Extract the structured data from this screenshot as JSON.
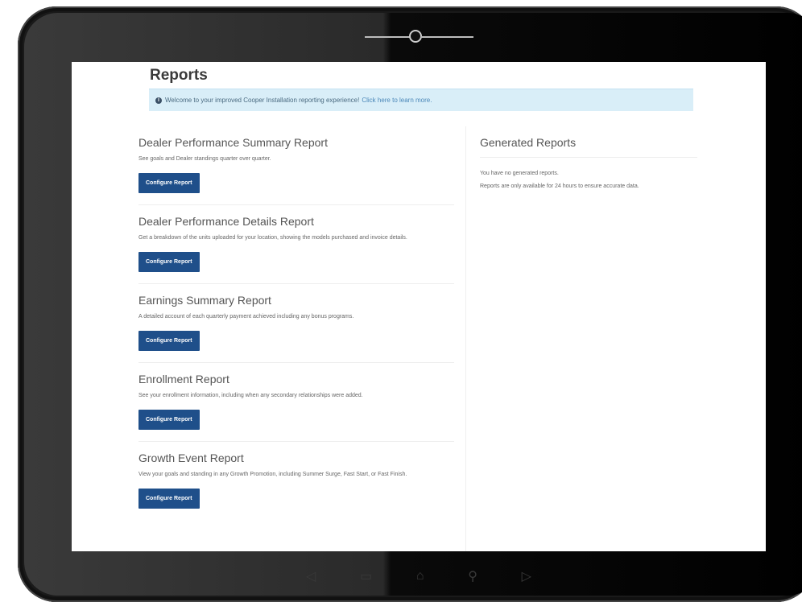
{
  "page": {
    "title": "Reports",
    "alert": {
      "text": "Welcome to your improved Cooper Installation reporting experience!",
      "link": "Click here to learn more."
    }
  },
  "reports": [
    {
      "title": "Dealer Performance Summary Report",
      "description": "See goals and Dealer standings quarter over quarter.",
      "button": "Configure Report"
    },
    {
      "title": "Dealer Performance Details Report",
      "description": "Get a breakdown of the units uploaded for your location, showing the models purchased and invoice details.",
      "button": "Configure Report"
    },
    {
      "title": "Earnings Summary Report",
      "description": "A detailed account of each quarterly payment achieved including any bonus programs.",
      "button": "Configure Report"
    },
    {
      "title": "Enrollment Report",
      "description": "See your enrollment information, including when any secondary relationships were added.",
      "button": "Configure Report"
    },
    {
      "title": "Growth Event Report",
      "description": "View your goals and standing in any Growth Promotion, including Summer Surge, Fast Start, or Fast Finish.",
      "button": "Configure Report"
    }
  ],
  "generated": {
    "title": "Generated Reports",
    "empty_text": "You have no generated reports.",
    "note": "Reports are only available for 24 hours to ensure accurate data."
  },
  "tablet_nav": {
    "icons": [
      "back-icon",
      "recent-apps-icon",
      "home-icon",
      "search-icon",
      "forward-icon"
    ]
  }
}
